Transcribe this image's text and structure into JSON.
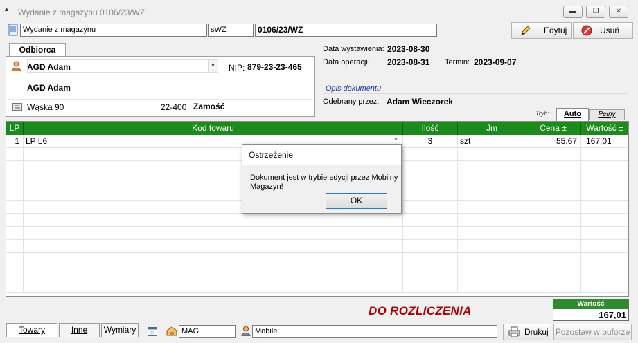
{
  "window": {
    "title": "Wydanie z magazynu 0106/23/WZ"
  },
  "toolbar": {
    "doc_type": "Wydanie z magazynu",
    "series": "sWZ",
    "number": "0106/23/WZ",
    "edit_label": "Edytuj",
    "delete_label": "Usuń"
  },
  "recipient": {
    "tab_label": "Odbiorca",
    "name": "AGD Adam",
    "nip_label": "NIP:",
    "nip": "879-23-23-465",
    "full_name": "AGD Adam",
    "street": "Wąska 90",
    "postal": "22-400",
    "city": "Zamość"
  },
  "dates": {
    "issue_label": "Data wystawienia:",
    "issue_date": "2023-08-30",
    "op_label": "Data operacji:",
    "op_date": "2023-08-31",
    "term_label": "Termin:",
    "term_date": "2023-09-07",
    "opis_label": "Opis dokumentu",
    "received_label": "Odebrany przez:",
    "received_by": "Adam Wieczorek"
  },
  "mode": {
    "label": "Tryb:",
    "auto": "Auto",
    "full": "Pełny"
  },
  "grid": {
    "headers": [
      "LP",
      "Kod towaru",
      "Ilość",
      "Jm",
      "Cena ±",
      "Wartość ±"
    ],
    "rows": [
      {
        "lp": "1",
        "code": "LP L6",
        "qty": "3",
        "unit": "szt",
        "price": "55,67",
        "value": "167,01"
      }
    ]
  },
  "dialog": {
    "title": "Ostrzeżenie",
    "message": "Dokument jest w trybie edycji przez Mobilny Magazyn!",
    "ok_label": "OK"
  },
  "summary": {
    "status": "DO ROZLICZENIA",
    "total_label": "Wartość",
    "total": "167,01"
  },
  "bottom": {
    "tabs": [
      "Towary",
      "Inne",
      "Wymiary"
    ],
    "warehouse": "MAG",
    "user": "Mobile",
    "print_label": "Drukuj",
    "buffer_label": "Pozostaw w buforze"
  },
  "colors": {
    "grid_header": "#1c8a1c",
    "status_red": "#b00000",
    "total_header": "#2e8b2e"
  }
}
